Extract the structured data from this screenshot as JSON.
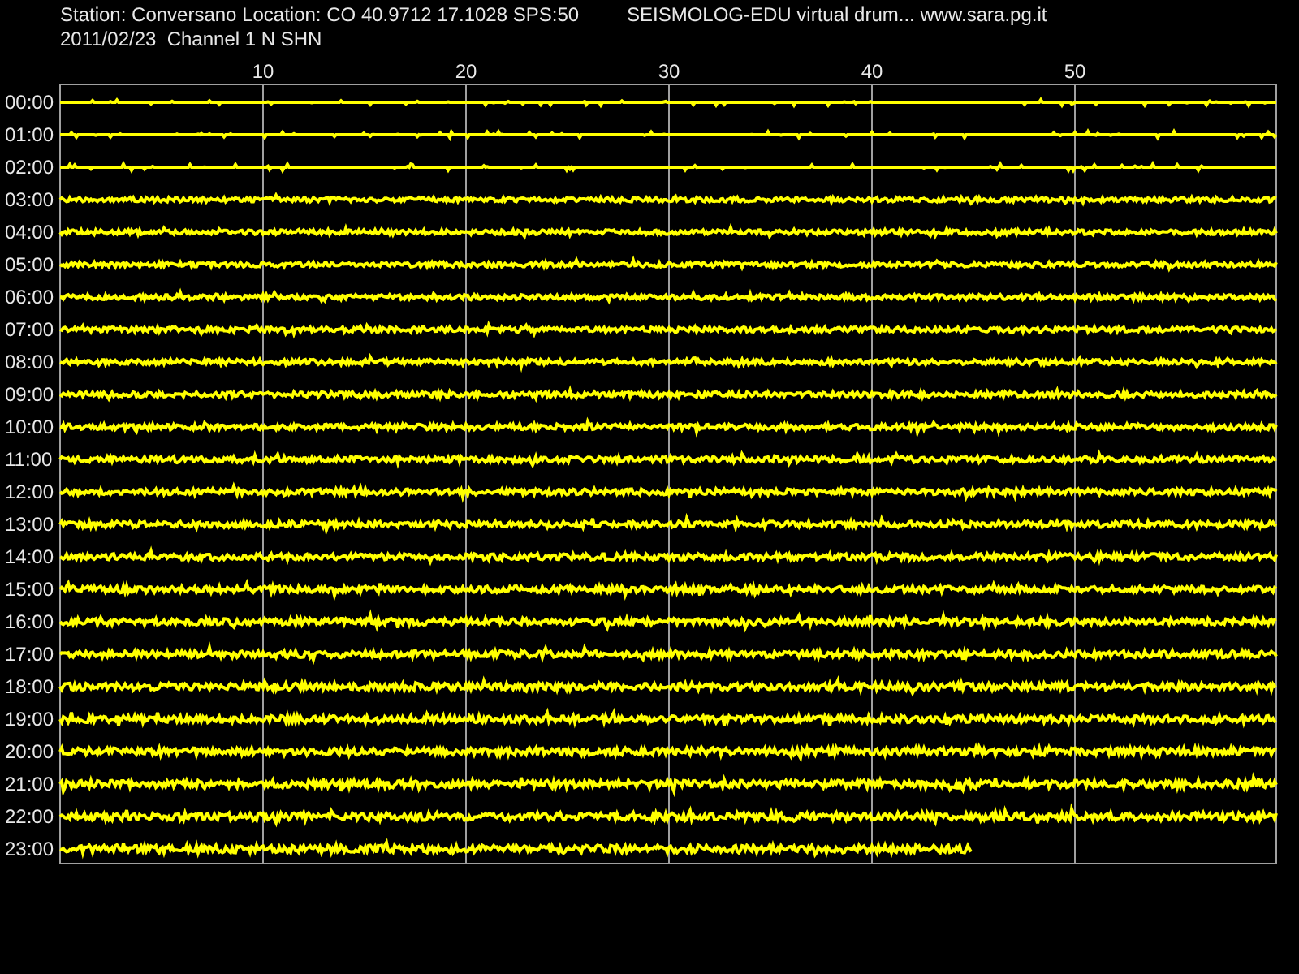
{
  "header": {
    "station": "Station: Conversano Location: CO 40.9712 17.1028 SPS:50",
    "title": "SEISMOLOG-EDU virtual drum... www.sara.pg.it",
    "date_channel": "2011/02/23  Channel 1 N SHN"
  },
  "minute_ticks": [
    "10",
    "20",
    "30",
    "40",
    "50"
  ],
  "traces": [
    {
      "hour": "00:00",
      "kind": "quiet",
      "level": 1
    },
    {
      "hour": "01:00",
      "kind": "quiet",
      "level": 1
    },
    {
      "hour": "02:00",
      "kind": "quiet",
      "level": 1
    },
    {
      "hour": "03:00",
      "kind": "noisy",
      "level": 1
    },
    {
      "hour": "04:00",
      "kind": "noisy",
      "level": 1
    },
    {
      "hour": "05:00",
      "kind": "noisy",
      "level": 1
    },
    {
      "hour": "06:00",
      "kind": "noisy",
      "level": 1
    },
    {
      "hour": "07:00",
      "kind": "noisy",
      "level": 1
    },
    {
      "hour": "08:00",
      "kind": "noisy",
      "level": 1
    },
    {
      "hour": "09:00",
      "kind": "noisy",
      "level": 1
    },
    {
      "hour": "10:00",
      "kind": "noisy",
      "level": 1
    },
    {
      "hour": "11:00",
      "kind": "noisy",
      "level": 1
    },
    {
      "hour": "12:00",
      "kind": "noisy",
      "level": 1
    },
    {
      "hour": "13:00",
      "kind": "noisy",
      "level": 1
    },
    {
      "hour": "14:00",
      "kind": "noisy",
      "level": 1
    },
    {
      "hour": "15:00",
      "kind": "noisy",
      "level": 1
    },
    {
      "hour": "16:00",
      "kind": "noisy",
      "level": 1
    },
    {
      "hour": "17:00",
      "kind": "noisy",
      "level": 1
    },
    {
      "hour": "18:00",
      "kind": "noisy",
      "level": 1
    },
    {
      "hour": "19:00",
      "kind": "noisy",
      "level": 1
    },
    {
      "hour": "20:00",
      "kind": "noisy",
      "level": 1
    },
    {
      "hour": "21:00",
      "kind": "noisy",
      "level": 1
    },
    {
      "hour": "22:00",
      "kind": "noisy",
      "level": 1
    },
    {
      "hour": "23:00",
      "kind": "noisy",
      "level": 0.75
    }
  ]
}
